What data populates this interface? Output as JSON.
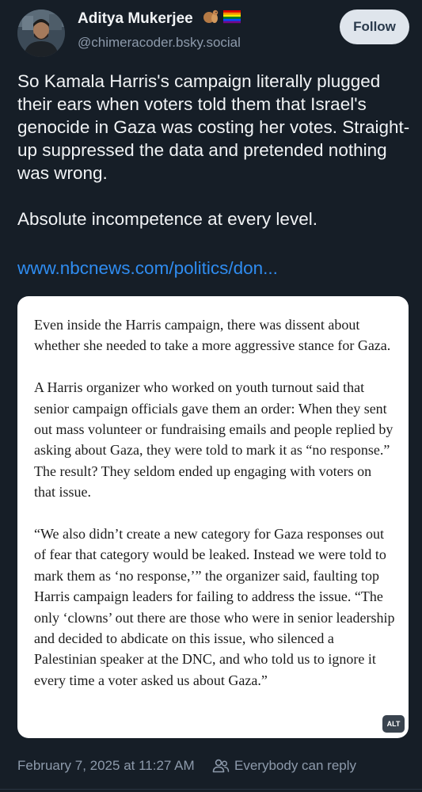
{
  "author": {
    "display_name": "Aditya Mukerjee",
    "handle": "@chimeracoder.bsky.social",
    "badges": [
      "squirrel-emoji-icon",
      "rainbow-flag-icon"
    ]
  },
  "follow": {
    "label": "Follow"
  },
  "post": {
    "paragraphs": [
      "So Kamala Harris's campaign literally plugged their ears when voters told them that Israel's genocide in Gaza was costing her votes. Straight-up suppressed the data and pretended nothing was wrong.",
      "Absolute incompetence at every level."
    ],
    "link_text": "www.nbcnews.com/politics/don..."
  },
  "embed": {
    "paragraphs": [
      "Even inside the Harris campaign, there was dissent about whether she needed to take a more aggressive stance for Gaza.",
      "A Harris organizer who worked on youth turnout said that senior campaign officials gave them an order: When they sent out mass volunteer or fundraising emails and people replied by asking about Gaza, they were told to mark it as “no response.” The result? They seldom ended up engaging with voters on that issue.",
      "“We also didn’t create a new category for Gaza responses out of fear that category would be leaked. Instead we were told to mark them as ‘no response,’” the organizer said, faulting top Harris campaign leaders for failing to address the issue. “The only ‘clowns’ out there are those who were in senior leadership and decided to abdicate on this issue, who silenced a Palestinian speaker at the DNC, and who told us to ignore it every time a voter asked us about Gaza.”"
    ],
    "alt_label": "ALT"
  },
  "footer": {
    "timestamp": "February 7, 2025 at 11:27 AM",
    "reply_setting": "Everybody can reply"
  },
  "colors": {
    "background": "#161e27",
    "link": "#2f8cf0",
    "muted": "#8d9aab",
    "follow_bg": "#dfe5ec"
  }
}
